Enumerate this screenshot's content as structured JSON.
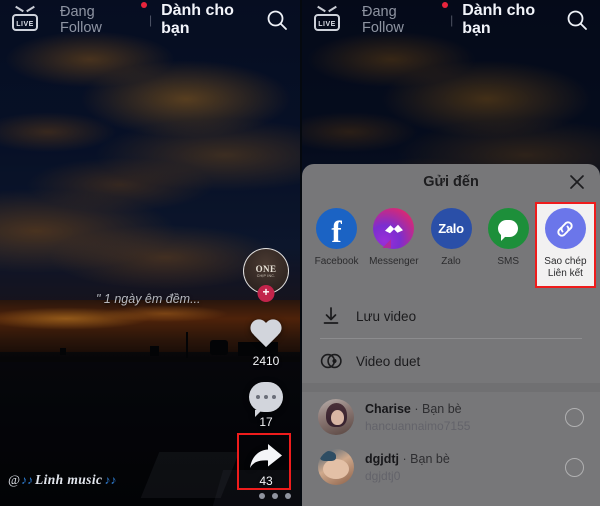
{
  "topbar": {
    "live_label": "LIVE",
    "following_label": "Đang Follow",
    "separator": "|",
    "for_you_label": "Dành cho bạn",
    "search_icon": "search-icon"
  },
  "left_panel": {
    "caption": "\" 1 ngày êm đềm...",
    "watermark": {
      "at": "@",
      "note_left": "♪♪",
      "name": "Linh music",
      "note_right": "♪♪"
    },
    "rail": {
      "avatar_top_text": "ONE",
      "avatar_sub_text": "CHỊP INC.",
      "follow_plus": "+",
      "like_count": "2410",
      "comment_count": "17",
      "share_count": "43"
    }
  },
  "share_sheet": {
    "title": "Gửi đến",
    "close_icon": "close-icon",
    "apps": [
      {
        "label": "Facebook",
        "icon": "facebook-icon",
        "color": "#1b63c4",
        "highlighted": false
      },
      {
        "label": "Messenger",
        "icon": "messenger-icon",
        "color": "#9a2fd8",
        "highlighted": false
      },
      {
        "label": "Zalo",
        "icon": "zalo-icon",
        "color": "#2a4fa8",
        "highlighted": false,
        "glyph": "Zalo"
      },
      {
        "label": "SMS",
        "icon": "sms-icon",
        "color": "#1d8f3a",
        "highlighted": false
      },
      {
        "label": "Sao chép\nLiên kết",
        "label_line1": "Sao chép",
        "label_line2": "Liên kết",
        "icon": "link-icon",
        "color": "#6b76ea",
        "highlighted": true
      }
    ],
    "actions": [
      {
        "label": "Lưu video",
        "icon": "download-icon"
      },
      {
        "label": "Video duet",
        "icon": "duet-icon"
      }
    ],
    "friends": [
      {
        "name": "Charise",
        "separator": "·",
        "relation": "Bạn bè",
        "handle": "hancuannaimo7155",
        "avatar": "friend-avatar"
      },
      {
        "name": "dgjdtj",
        "separator": "·",
        "relation": "Bạn bè",
        "handle": "dgjdtj0",
        "avatar": "friend-avatar"
      }
    ]
  },
  "highlight_color": "#ef1c1c"
}
